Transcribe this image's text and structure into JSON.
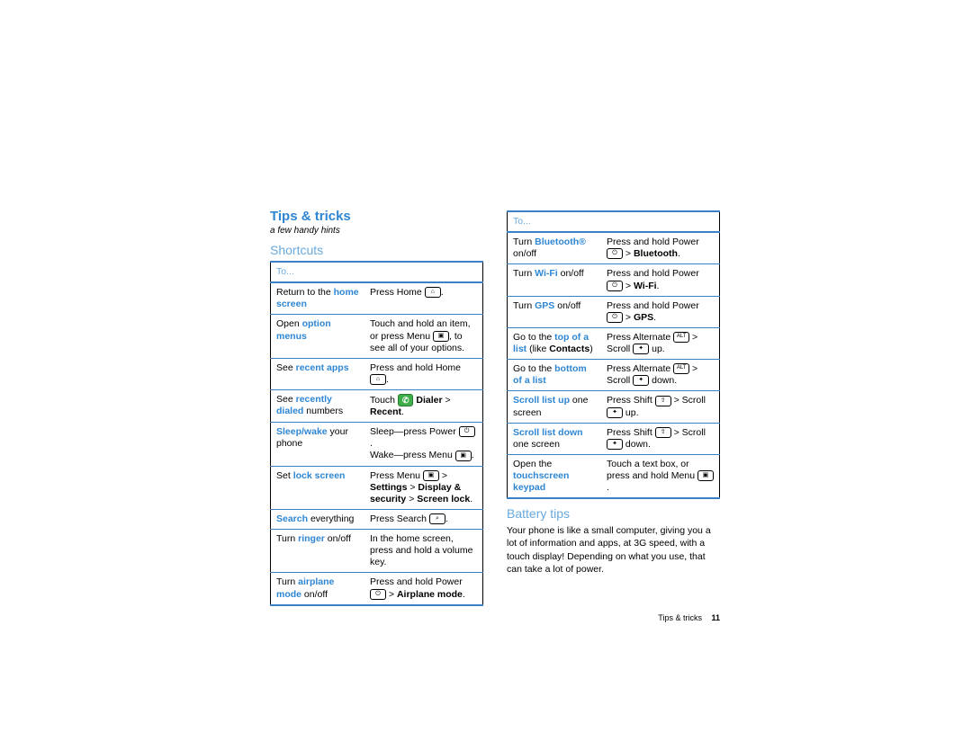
{
  "header": {
    "title": "Tips & tricks",
    "subtitle": "a few handy hints"
  },
  "shortcuts": {
    "heading": "Shortcuts",
    "toLabel": "To...",
    "rows": [
      {
        "l1": "Return to the ",
        "l2": "home screen",
        "l3": "",
        "r_pre": "Press Home ",
        "r_icon": "home",
        "r_post": "."
      },
      {
        "l1": "Open ",
        "l2": "option menus",
        "l3": "",
        "r_html": "Touch and hold an item, or press Menu {menu}, to see all of your options."
      },
      {
        "l1": "See ",
        "l2": "recent apps",
        "l3": "",
        "r_html": "Press and hold Home {home}."
      },
      {
        "l1": "See ",
        "l2": "recently dialed",
        "l3": " numbers",
        "r_html": "Touch {dialer} <b>Dialer</b> > <b>Recent</b>."
      },
      {
        "l1": "",
        "l2": "Sleep/wake",
        "l3": " your phone",
        "r_html": "Sleep—press Power {power}.<br>Wake—press Menu {menu}."
      },
      {
        "l1": "Set ",
        "l2": "lock screen",
        "l3": "",
        "r_html": "Press Menu {menu} > <b>Settings</b> > <b>Display & security</b> > <b>Screen lock</b>."
      },
      {
        "l1": "",
        "l2": "Search",
        "l3": " everything",
        "r_html": "Press Search {search}."
      },
      {
        "l1": "Turn ",
        "l2": "ringer",
        "l3": " on/off",
        "r_html": "In the home screen, press and hold a volume key."
      },
      {
        "l1": "Turn ",
        "l2": "airplane mode",
        "l3": " on/off",
        "r_html": "Press and hold Power {power} > <b>Airplane mode</b>."
      }
    ]
  },
  "shortcuts2": {
    "toLabel": "To...",
    "rows": [
      {
        "l1": "Turn ",
        "l2": "Bluetooth®",
        "l3": " on/off",
        "r_html": "Press and hold Power {power} > <b>Bluetooth</b>."
      },
      {
        "l1": "Turn ",
        "l2": "Wi-Fi",
        "l3": " on/off",
        "r_html": "Press and hold Power {power} > <b>Wi-Fi</b>."
      },
      {
        "l1": "Turn ",
        "l2": "GPS",
        "l3": " on/off",
        "r_html": "Press and hold Power {power} > <b>GPS</b>."
      },
      {
        "l1": "Go to the ",
        "l2": "top of a list",
        "l3": " (like ",
        "l4": "Contacts",
        "l5": ")",
        "r_html": "Press Alternate {alt} > Scroll {nav} up."
      },
      {
        "l1": "Go to the ",
        "l2": "bottom of a list",
        "l3": "",
        "r_html": "Press Alternate {alt} > Scroll {nav} down."
      },
      {
        "l1": "",
        "l2": "Scroll list up",
        "l3": " one screen",
        "r_html": "Press Shift {shift} > Scroll {nav} up."
      },
      {
        "l1": "",
        "l2": "Scroll list down",
        "l3": " one screen",
        "r_html": "Press Shift {shift} > Scroll {nav} down."
      },
      {
        "l1": "Open the ",
        "l2": "touchscreen keypad",
        "l3": "",
        "r_html": "Touch a text box, or press and hold Menu {menu}."
      }
    ]
  },
  "battery": {
    "heading": "Battery tips",
    "body": "Your phone is like a small computer, giving you a lot of information and apps, at 3G speed, with a touch display! Depending on what you use, that can take a lot of power."
  },
  "footer": {
    "text": "Tips & tricks",
    "page": "11"
  }
}
